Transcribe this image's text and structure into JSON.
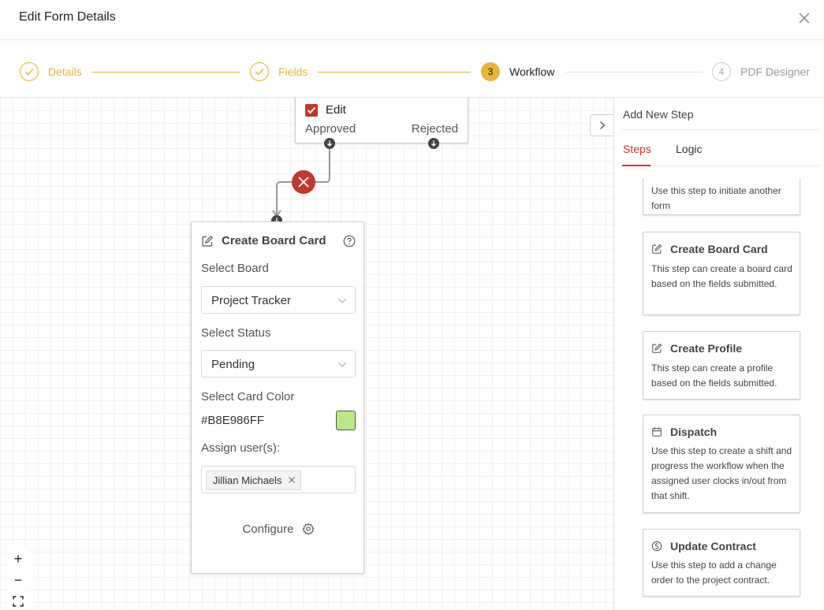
{
  "header": {
    "title": "Edit Form Details"
  },
  "stepper": {
    "steps": [
      {
        "label": "Details",
        "state": "done"
      },
      {
        "label": "Fields",
        "state": "done"
      },
      {
        "label": "Workflow",
        "state": "active",
        "number": "3"
      },
      {
        "label": "PDF Designer",
        "state": "todo",
        "number": "4"
      }
    ]
  },
  "canvas": {
    "top_node": {
      "title": "Edit",
      "approved_label": "Approved",
      "rejected_label": "Rejected"
    },
    "board_card": {
      "title": "Create Board Card",
      "select_board_label": "Select Board",
      "board_value": "Project Tracker",
      "select_status_label": "Select Status",
      "status_value": "Pending",
      "card_color_label": "Select Card Color",
      "card_color_value": "#B8E986FF",
      "card_color_hex": "#B8E986",
      "assign_users_label": "Assign user(s):",
      "assigned_users": [
        "Jillian Michaels"
      ],
      "configure_label": "Configure"
    },
    "zoom_controls": {
      "zoom_in": "+",
      "zoom_out": "−"
    }
  },
  "colors": {
    "accent": "#e8b43a",
    "danger": "#c0392b"
  },
  "panel": {
    "title": "Add New Step",
    "tabs": [
      {
        "label": "Steps",
        "active": true
      },
      {
        "label": "Logic",
        "active": false
      }
    ],
    "cards": [
      {
        "title": "",
        "icon": "",
        "description": "Use this step to initiate another form"
      },
      {
        "title": "Create Board Card",
        "icon": "edit-icon",
        "description": "This step can create a board card based on the fields submitted."
      },
      {
        "title": "Create Profile",
        "icon": "edit-icon",
        "description": "This step can create a profile based on the fields submitted."
      },
      {
        "title": "Dispatch",
        "icon": "calendar-icon",
        "description": "Use this step to create a shift and progress the workflow when the assigned user clocks in/out from that shift."
      },
      {
        "title": "Update Contract",
        "icon": "dollar-circle-icon",
        "description": "Use this step to add a change order to the project contract."
      }
    ]
  }
}
